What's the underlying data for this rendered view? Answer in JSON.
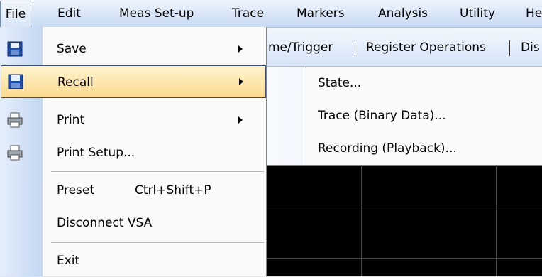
{
  "menubar": {
    "items": [
      {
        "label": "File"
      },
      {
        "label": "Edit"
      },
      {
        "label": "Meas Set-up"
      },
      {
        "label": "Trace"
      },
      {
        "label": "Markers"
      },
      {
        "label": "Analysis"
      },
      {
        "label": "Utility"
      },
      {
        "label": "He"
      }
    ]
  },
  "toolbar": {
    "items": [
      {
        "label": "me/Trigger"
      },
      {
        "label": "Register Operations"
      },
      {
        "label": "Dis"
      }
    ]
  },
  "file_menu": {
    "items": [
      {
        "label": "Save",
        "icon": "floppy-disk-icon",
        "has_submenu": true
      },
      {
        "label": "Recall",
        "icon": "floppy-disk-icon",
        "has_submenu": true,
        "highlighted": true
      },
      {
        "label": "Print",
        "icon": "printer-icon",
        "has_submenu": true
      },
      {
        "label": "Print Setup...",
        "icon": "printer-icon"
      },
      {
        "label": "Preset",
        "shortcut": "Ctrl+Shift+P"
      },
      {
        "label": "Disconnect VSA"
      },
      {
        "label": "Exit"
      }
    ]
  },
  "recall_submenu": {
    "items": [
      {
        "label": "State..."
      },
      {
        "label": "Trace (Binary Data)..."
      },
      {
        "label": "Recording (Playback)..."
      }
    ]
  },
  "colors": {
    "highlight": "#fcd98f",
    "menubar": "#c8daf3",
    "display_bg": "#000000"
  }
}
